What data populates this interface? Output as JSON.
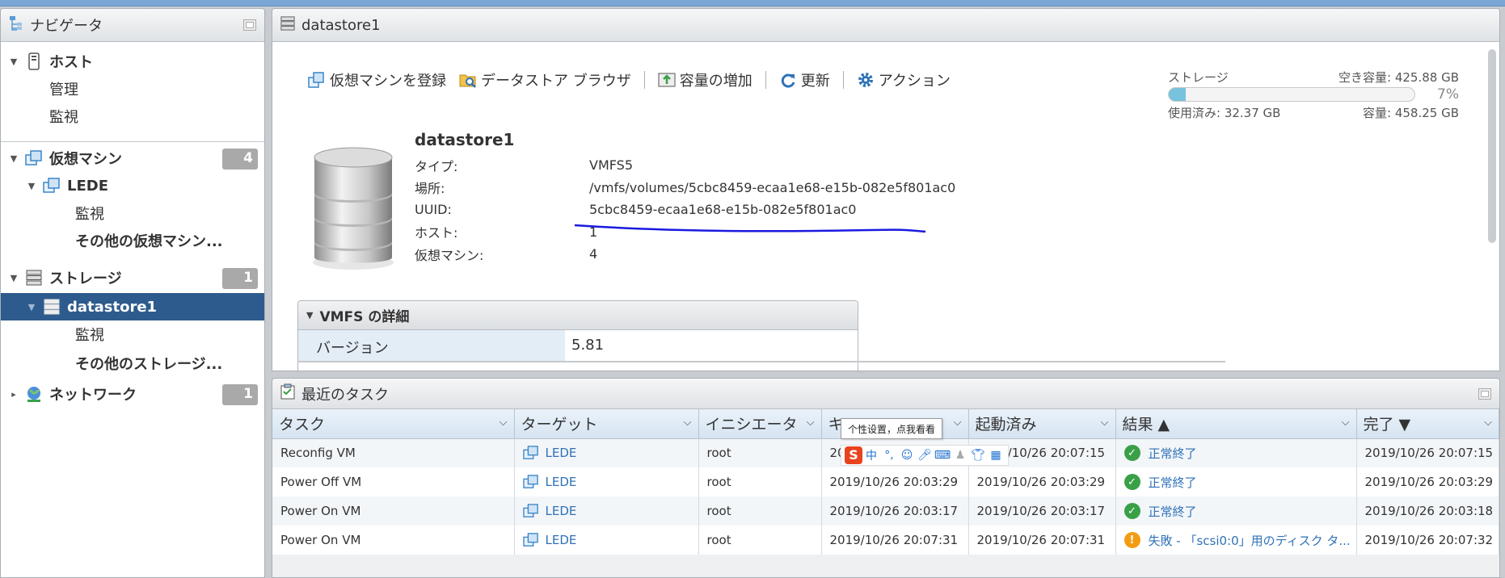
{
  "navigator": {
    "title": "ナビゲータ",
    "items": {
      "host": "ホスト",
      "manage": "管理",
      "monitor_host": "監視",
      "vms": "仮想マシン",
      "vms_count": "4",
      "lede": "LEDE",
      "lede_monitor": "監視",
      "more_vms": "その他の仮想マシン...",
      "storage": "ストレージ",
      "storage_count": "1",
      "datastore": "datastore1",
      "ds_monitor": "監視",
      "more_storage": "その他のストレージ...",
      "network": "ネットワーク",
      "network_count": "1"
    }
  },
  "datastore_panel": {
    "title": "datastore1",
    "toolbar": {
      "register_vm": "仮想マシンを登録",
      "browser": "データストア ブラウザ",
      "increase": "容量の増加",
      "refresh": "更新",
      "actions": "アクション"
    },
    "storage": {
      "label": "ストレージ",
      "free": "空き容量: 425.88 GB",
      "percent": "7%",
      "used_fraction": 0.07,
      "used": "使用済み: 32.37 GB",
      "capacity": "容量: 458.25 GB"
    },
    "info": {
      "name": "datastore1",
      "type_label": "タイプ:",
      "type_value": "VMFS5",
      "location_label": "場所:",
      "location_value": "/vmfs/volumes/5cbc8459-ecaa1e68-e15b-082e5f801ac0",
      "uuid_label": "UUID:",
      "uuid_value": "5cbc8459-ecaa1e68-e15b-082e5f801ac0",
      "host_label": "ホスト:",
      "host_value": "1",
      "vm_label": "仮想マシン:",
      "vm_value": "4"
    },
    "vmfs": {
      "title": "VMFS の詳細",
      "version_label": "バージョン",
      "version_value": "5.81"
    }
  },
  "tasks": {
    "title": "最近のタスク",
    "columns": [
      "タスク",
      "ターゲット",
      "イニシエータ",
      "キ",
      "起動済み",
      "結果 ▲",
      "完了 ▼"
    ],
    "rows": [
      {
        "task": "Reconfig VM",
        "target": "LEDE",
        "initiator": "root",
        "queued": "20",
        "started": "2019/10/26 20:07:15",
        "result": "正常終了",
        "completed": "2019/10/26 20:07:15"
      },
      {
        "task": "Power Off VM",
        "target": "LEDE",
        "initiator": "root",
        "queued": "2019/10/26 20:03:29",
        "started": "2019/10/26 20:03:29",
        "result": "正常終了",
        "completed": "2019/10/26 20:03:29"
      },
      {
        "task": "Power On VM",
        "target": "LEDE",
        "initiator": "root",
        "queued": "2019/10/26 20:03:17",
        "started": "2019/10/26 20:03:17",
        "result": "正常終了",
        "completed": "2019/10/26 20:03:18"
      },
      {
        "task": "Power On VM",
        "target": "LEDE",
        "initiator": "root",
        "queued": "2019/10/26 20:07:31",
        "started": "2019/10/26 20:07:31",
        "result": "失敗 - 「scsi0:0」用のディスク タ...",
        "completed": "2019/10/26 20:07:32"
      }
    ]
  },
  "ime": {
    "tooltip": "个性设置，点我看看",
    "logo": "S",
    "chinese": "中"
  }
}
